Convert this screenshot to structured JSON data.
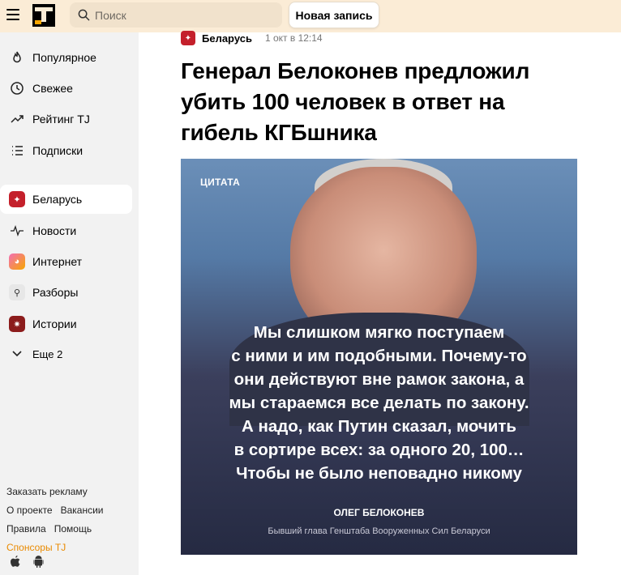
{
  "header": {
    "search_placeholder": "Поиск",
    "new_post_label": "Новая запись"
  },
  "sidebar": {
    "nav": [
      {
        "label": "Популярное",
        "icon": "flame-icon"
      },
      {
        "label": "Свежее",
        "icon": "clock-icon"
      },
      {
        "label": "Рейтинг TJ",
        "icon": "trending-up-icon"
      },
      {
        "label": "Подписки",
        "icon": "list-icon"
      }
    ],
    "subsites": [
      {
        "label": "Беларусь",
        "icon": "belarus-icon",
        "active": true
      },
      {
        "label": "Новости",
        "icon": "pulse-icon"
      },
      {
        "label": "Интернет",
        "icon": "doge-icon"
      },
      {
        "label": "Разборы",
        "icon": "telescope-icon"
      },
      {
        "label": "Истории",
        "icon": "stories-icon"
      }
    ],
    "more_label": "Еще 2",
    "footer": {
      "ads": "Заказать рекламу",
      "about": "О проекте",
      "jobs": "Вакансии",
      "rules": "Правила",
      "help": "Помощь",
      "sponsors": "Спонсоры TJ"
    }
  },
  "post": {
    "subsite": "Беларусь",
    "date": "1 окт в 12:14",
    "title": "Генерал Белоконев предложил убить 100 человек в ответ на гибель КГБшника",
    "image": {
      "label": "ЦИТАТА",
      "quote_lines": [
        "Мы слишком мягко поступаем",
        "с ними и им подобными. Почему-то",
        "они действуют вне рамок закона, а",
        "мы стараемся все делать по закону.",
        "А надо, как Путин сказал, мочить",
        "в сортире всех: за одного 20, 100…",
        "Чтобы не было неповадно никому"
      ],
      "author": "ОЛЕГ БЕЛОКОНЕВ",
      "author_role": "Бывший глава Генштаба Вооруженных Сил Беларуси"
    }
  },
  "colors": {
    "header_bg": "#fbecd6",
    "accent_orange": "#e98a00",
    "subsite_red": "#c4202b"
  }
}
